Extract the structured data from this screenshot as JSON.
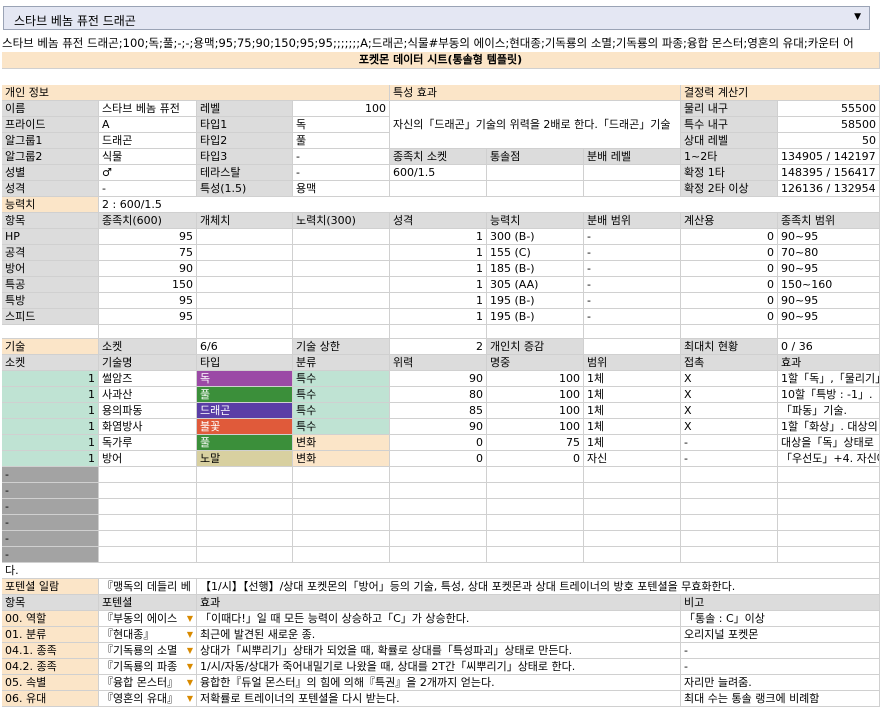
{
  "top_select": "스타브 베놈 퓨전 드래곤",
  "raw_line": "스타브 베놈 퓨전 드래곤;100;독;풀;-;-;용맥;95;75;90;150;95;95;;;;;;;A;드래곤;식물#부동의 에이스;현대종;기독룡의 소멸;기독룡의 파종;융합 몬스터;영혼의 유대;카운터 어",
  "sheet_title": "포켓몬 데이터 시트(통솔형 템플릿)",
  "sections": {
    "personal": "개인 정보",
    "trait": "특성 효과",
    "decisive": "결정력 계산기"
  },
  "personal": {
    "rows": [
      {
        "k1": "이름",
        "v1": "스타브 베놈 퓨전",
        "k2": "레벨",
        "v2": "100"
      },
      {
        "k1": "프라이드",
        "v1": "A",
        "k2": "타입1",
        "v2": "독"
      },
      {
        "k1": "알그룹1",
        "v1": "드래곤",
        "k2": "타입2",
        "v2": "풀"
      },
      {
        "k1": "알그룹2",
        "v1": "식물",
        "k2": "타입3",
        "v2": "-"
      },
      {
        "k1": "성별",
        "v1": "♂",
        "k2": "테라스탈",
        "v2": "-"
      },
      {
        "k1": "성격",
        "v1": "-",
        "k2": "특성(1.5)",
        "v2": "용맥"
      }
    ],
    "ability_label": "능력치",
    "ability_value": "2 : 600/1.5"
  },
  "trait_text": "자신의「드래곤」기술의 위력을 2배로 한다.「드래곤」기술",
  "trait_sub": {
    "h1": "종족치 소켓",
    "h2": "통솔점",
    "h3": "분배 레벨",
    "v1": "600/1.5"
  },
  "decisive": [
    {
      "k": "물리 내구",
      "v": "55500"
    },
    {
      "k": "특수 내구",
      "v": "58500"
    },
    {
      "k": "상대 레벨",
      "v": "50"
    },
    {
      "k": "1~2타",
      "v": "134905 / 142197"
    },
    {
      "k": "확정 1타",
      "v": "148395 / 156417"
    },
    {
      "k": "확정 2타 이상",
      "v": "126136 / 132954"
    }
  ],
  "stats_header": [
    "항목",
    "종족치(600)",
    "개체치",
    "노력치(300)",
    "성격",
    "능력치",
    "분배 범위",
    "계산용",
    "종족치 범위"
  ],
  "stats": [
    {
      "name": "HP",
      "base": "95",
      "nature": "1",
      "stat": "300 (B-)",
      "dist": "-",
      "calc": "0",
      "range": "90~95"
    },
    {
      "name": "공격",
      "base": "75",
      "nature": "1",
      "stat": "155 (C)",
      "dist": "-",
      "calc": "0",
      "range": "70~80"
    },
    {
      "name": "방어",
      "base": "90",
      "nature": "1",
      "stat": "185 (B-)",
      "dist": "-",
      "calc": "0",
      "range": "90~95"
    },
    {
      "name": "특공",
      "base": "150",
      "nature": "1",
      "stat": "305 (AA)",
      "dist": "-",
      "calc": "0",
      "range": "150~160"
    },
    {
      "name": "특방",
      "base": "95",
      "nature": "1",
      "stat": "195 (B-)",
      "dist": "-",
      "calc": "0",
      "range": "90~95"
    },
    {
      "name": "스피드",
      "base": "95",
      "nature": "1",
      "stat": "195 (B-)",
      "dist": "-",
      "calc": "0",
      "range": "90~95"
    }
  ],
  "skills_info": {
    "l1": "기술",
    "l2": "소켓",
    "v2": "6/6",
    "l3": "기술 상한",
    "v3": "2",
    "l4": "개인치 증감",
    "l5": "최대치 현황",
    "v5": "0 / 36"
  },
  "skills_header": [
    "소켓",
    "기술명",
    "타입",
    "분류",
    "위력",
    "명중",
    "범위",
    "접촉",
    "효과"
  ],
  "skills": [
    {
      "socket": "1",
      "name": "썰암즈",
      "type": "독",
      "type_color": "#9b4aa6",
      "cls": "특수",
      "cls_color": "#bfe3d3",
      "power": "90",
      "acc": "100",
      "range": "1체",
      "contact": "X",
      "effect": "1할「독」,「물리기」"
    },
    {
      "socket": "1",
      "name": "사과산",
      "type": "풀",
      "type_color": "#3b8f3a",
      "cls": "특수",
      "cls_color": "#bfe3d3",
      "power": "80",
      "acc": "100",
      "range": "1체",
      "contact": "X",
      "effect": "10할「특방 : -1」."
    },
    {
      "socket": "1",
      "name": "용의파동",
      "type": "드래곤",
      "type_color": "#5a3ea6",
      "cls": "특수",
      "cls_color": "#bfe3d3",
      "power": "85",
      "acc": "100",
      "range": "1체",
      "contact": "X",
      "effect": "「파동」기술."
    },
    {
      "socket": "1",
      "name": "화염방사",
      "type": "불꽃",
      "type_color": "#e05a3a",
      "cls": "특수",
      "cls_color": "#bfe3d3",
      "power": "90",
      "acc": "100",
      "range": "1체",
      "contact": "X",
      "effect": "1할「화상」. 대상의"
    },
    {
      "socket": "1",
      "name": "독가루",
      "type": "풀",
      "type_color": "#3b8f3a",
      "cls": "변화",
      "cls_color": "#fbe5c8",
      "power": "0",
      "acc": "75",
      "range": "1체",
      "contact": "-",
      "effect": "대상을「독」상태로"
    },
    {
      "socket": "1",
      "name": "방어",
      "type": "노말",
      "type_color": "#d8d0a0",
      "cls": "변화",
      "cls_color": "#fbe5c8",
      "power": "0",
      "acc": "0",
      "range": "자신",
      "contact": "-",
      "effect": "「우선도」+4. 자신에"
    }
  ],
  "empty_socket": "-",
  "note_line": "다.",
  "potential_label": "포텐셜 일람",
  "potential_desc1": "『맹독의 데들리 베",
  "potential_desc2": "【1/시】【선행】/상대 포켓몬의「방어」등의 기술, 특성, 상대 포켓몬과 상대 트레이너의 방호 포텐셜을 무효화한다.",
  "potential_header": [
    "항목",
    "포텐셜",
    "효과",
    "비고"
  ],
  "potentials": [
    {
      "item": "00. 역할",
      "pot": "『부동의 에이스",
      "effect": "「이때다!」일 때 모든 능력이 상승하고「C」가 상승한다.",
      "note": "「통솔 : C」이상"
    },
    {
      "item": "01. 분류",
      "pot": "『현대종』",
      "effect": "최근에 발견된 새로운 종.",
      "note": "오리지널 포켓몬"
    },
    {
      "item": "04.1. 종족",
      "pot": "『기독룡의 소멸",
      "effect": "상대가「씨뿌리기」상태가 되었을 때, 확률로 상대를「특성파괴」상태로 만든다.",
      "note": "-"
    },
    {
      "item": "04.2. 종족",
      "pot": "『기독룡의 파종",
      "effect": "1/시/자동/상대가 죽어내밀기로 나왔을 때, 상대를 2T간「씨뿌리기」상태로 한다.",
      "note": "-"
    },
    {
      "item": "05. 속별",
      "pot": "『융합 몬스터』",
      "effect": "융합한『듀얼 몬스터』의 힘에 의해『특권』을 2개까지 얻는다.",
      "note": "자리만 늘려줌."
    },
    {
      "item": "06. 유대",
      "pot": "『영혼의 유대』",
      "effect": "저확률로 트레이너의 포텐셜을 다시 받는다.",
      "note": "최대 수는 통솔 랭크에 비례함"
    }
  ],
  "dropdown_arrow": "▼"
}
